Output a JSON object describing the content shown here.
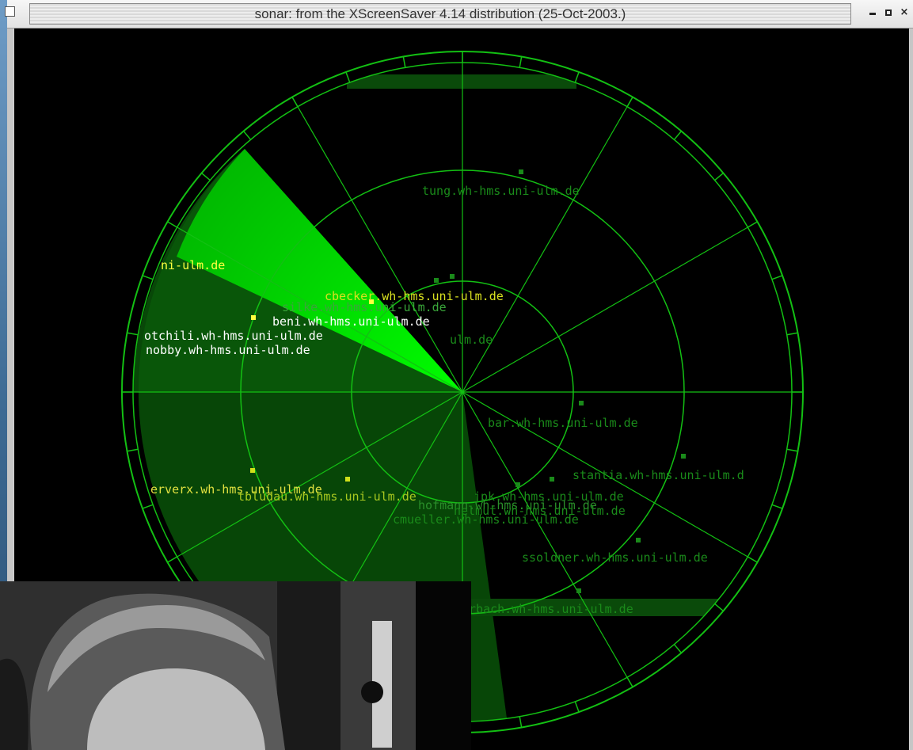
{
  "window": {
    "title": "sonar: from the XScreenSaver 4.14 distribution (25-Oct-2003.)",
    "controls": {
      "minimize": "minimize",
      "maximize": "maximize",
      "close": "×"
    }
  },
  "sonar": {
    "hosts": [
      {
        "name": "tung.wh-hms.uni-ulm.de"
      },
      {
        "name": "ni-ulm.de"
      },
      {
        "name": "cbecker.wh-hms.uni-ulm.de"
      },
      {
        "name": "silke.wh-hms.uni-ulm.de"
      },
      {
        "name": "beni.wh-hms.uni-ulm.de"
      },
      {
        "name": "otchili.wh-hms.uni-ulm.de"
      },
      {
        "name": "nobby.wh-hms.uni-ulm.de"
      },
      {
        "name": "ulm.de"
      },
      {
        "name": "bar.wh-hms.uni-ulm.de"
      },
      {
        "name": "stantia.wh-hms.uni-ulm.d"
      },
      {
        "name": "erverx.wh-hms.uni-ulm.de"
      },
      {
        "name": "tbludau.wh-hms.uni-ulm.de"
      },
      {
        "name": "jpk.wh-hms.uni-ulm.de"
      },
      {
        "name": "hofmann.wh-hms.uni-ulm.de"
      },
      {
        "name": "helmut.wh-hms.uni-ulm.de"
      },
      {
        "name": "cmueller.wh-hms.uni-ulm.de"
      },
      {
        "name": "ssoldner.wh-hms.uni-ulm.de"
      },
      {
        "name": "irbach.wh-hms.uni-ulm.de"
      }
    ]
  },
  "colors": {
    "bright": "#2ef02e",
    "dim": "#1a8a1a",
    "grid": "#13c013",
    "highlight": "#ffff40"
  },
  "icons": {
    "menu": "window-menu-icon",
    "photo": "portrait-photo"
  }
}
